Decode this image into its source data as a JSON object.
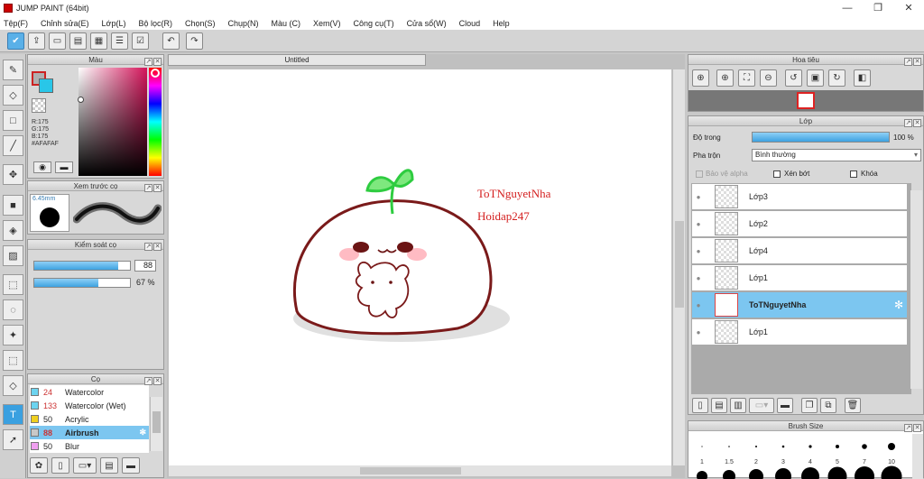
{
  "window": {
    "title": "JUMP PAINT (64bit)",
    "min": "—",
    "max": "❐",
    "close": "✕"
  },
  "menu": [
    "Tệp(F)",
    "Chỉnh sửa(E)",
    "Lớp(L)",
    "Bộ lọc(R)",
    "Chọn(S)",
    "Chụp(N)",
    "Màu (C)",
    "Xem(V)",
    "Công cụ(T)",
    "Cửa sổ(W)",
    "Cloud",
    "Help"
  ],
  "document": {
    "tab": "Untitled"
  },
  "canvas_text": {
    "line1": "ToTNguyetNha",
    "line2": "Hoidap247"
  },
  "color_panel": {
    "title": "Màu",
    "r": "R:175",
    "g": "G:175",
    "b": "B:175",
    "hex": "#AFAFAF",
    "primary": "#AFAFAF",
    "secondary": "#29c6e8"
  },
  "brush_preview": {
    "title": "Xem trước cọ",
    "size": "6.45mm"
  },
  "brush_control": {
    "title": "Kiểm soát cọ",
    "size": "88",
    "opacity": "67 %",
    "size_fill": 0.88,
    "opacity_fill": 0.67
  },
  "brush_panel": {
    "title": "Cọ",
    "items": [
      {
        "size": "24",
        "name": "Watercolor",
        "color": "#6cd4f0"
      },
      {
        "size": "133",
        "name": "Watercolor (Wet)",
        "color": "#6cd4f0"
      },
      {
        "size": "50",
        "name": "Acrylic",
        "color": "#f0d020"
      },
      {
        "size": "88",
        "name": "Airbrush",
        "color": "#c8c8c8"
      },
      {
        "size": "50",
        "name": "Blur",
        "color": "#f0a0f0"
      }
    ]
  },
  "navigator": {
    "title": "Hoa tiêu"
  },
  "layer_panel": {
    "title": "Lớp",
    "opacity_label": "Độ trong",
    "opacity_value": "100 %",
    "blend_label": "Pha trộn",
    "blend_value": "Bình thường",
    "protect_alpha": "Bảo vệ alpha",
    "clipping": "Xén bớt",
    "lock": "Khóa",
    "layers": [
      "Lớp3",
      "Lớp2",
      "Lớp4",
      "Lớp1",
      "ToTNguyetNha",
      "Lớp1"
    ]
  },
  "brush_size_panel": {
    "title": "Brush Size",
    "sizes": [
      "1",
      "1.5",
      "2",
      "3",
      "4",
      "5",
      "7",
      "10"
    ]
  }
}
